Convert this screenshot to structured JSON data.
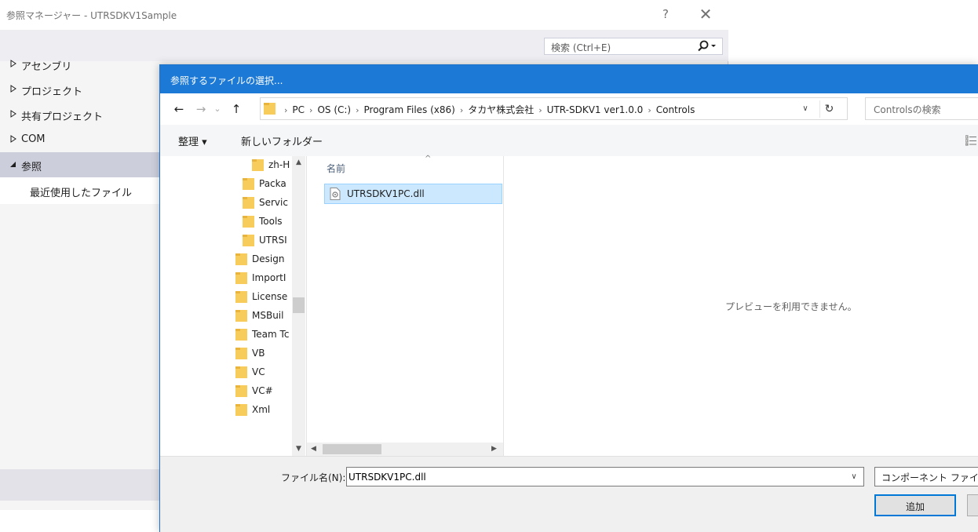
{
  "ref_manager": {
    "title": "参照マネージャー - UTRSDKV1Sample",
    "help_glyph": "?",
    "close_glyph": "✕",
    "search_placeholder": "検索 (Ctrl+E)",
    "sidebar": [
      {
        "label": "アセンブリ",
        "expanded": false
      },
      {
        "label": "プロジェクト",
        "expanded": false
      },
      {
        "label": "共有プロジェクト",
        "expanded": false
      },
      {
        "label": "COM",
        "expanded": false
      },
      {
        "label": "参照",
        "expanded": true,
        "selected": true
      }
    ],
    "sidebar_sub": "最近使用したファイル"
  },
  "dialog": {
    "title": "参照するファイルの選択...",
    "nav": {
      "back": "←",
      "forward": "→",
      "recent": "⌄",
      "up": "↑"
    },
    "breadcrumb": [
      "PC",
      "OS (C:)",
      "Program Files (x86)",
      "タカヤ株式会社",
      "UTR-SDKV1 ver1.0.0",
      "Controls"
    ],
    "breadcrumb_sep": "›",
    "breadcrumb_lead_sep": "›",
    "address_dropdown": "∨",
    "refresh": "↻",
    "search_placeholder": "Controlsの検索",
    "toolbar": {
      "organize": "整理 ▾",
      "new_folder": "新しいフォルダー"
    },
    "tree": [
      {
        "name": "zh-H",
        "indent": 2
      },
      {
        "name": "Packa",
        "indent": 1
      },
      {
        "name": "Servic",
        "indent": 1
      },
      {
        "name": "Tools",
        "indent": 1
      },
      {
        "name": "UTRSI",
        "indent": 1
      },
      {
        "name": "Design",
        "indent": 0
      },
      {
        "name": "ImportI",
        "indent": 0
      },
      {
        "name": "License",
        "indent": 0
      },
      {
        "name": "MSBuil",
        "indent": 0
      },
      {
        "name": "Team Tc",
        "indent": 0
      },
      {
        "name": "VB",
        "indent": 0
      },
      {
        "name": "VC",
        "indent": 0
      },
      {
        "name": "VC#",
        "indent": 0
      },
      {
        "name": "Xml",
        "indent": 0
      }
    ],
    "columns": {
      "name": "名前"
    },
    "files": [
      {
        "name": "UTRSDKV1PC.dll",
        "selected": true
      }
    ],
    "preview_text": "プレビューを利用できません。",
    "filename_label": "ファイル名(N):",
    "filename_value": "UTRSDKV1PC.dll",
    "filter_label": "コンポーネント ファイル",
    "add_button": "追加"
  },
  "colors": {
    "title_blue": "#1c79d6",
    "selection": "#cce8ff",
    "folder": "#f7cc5a"
  }
}
